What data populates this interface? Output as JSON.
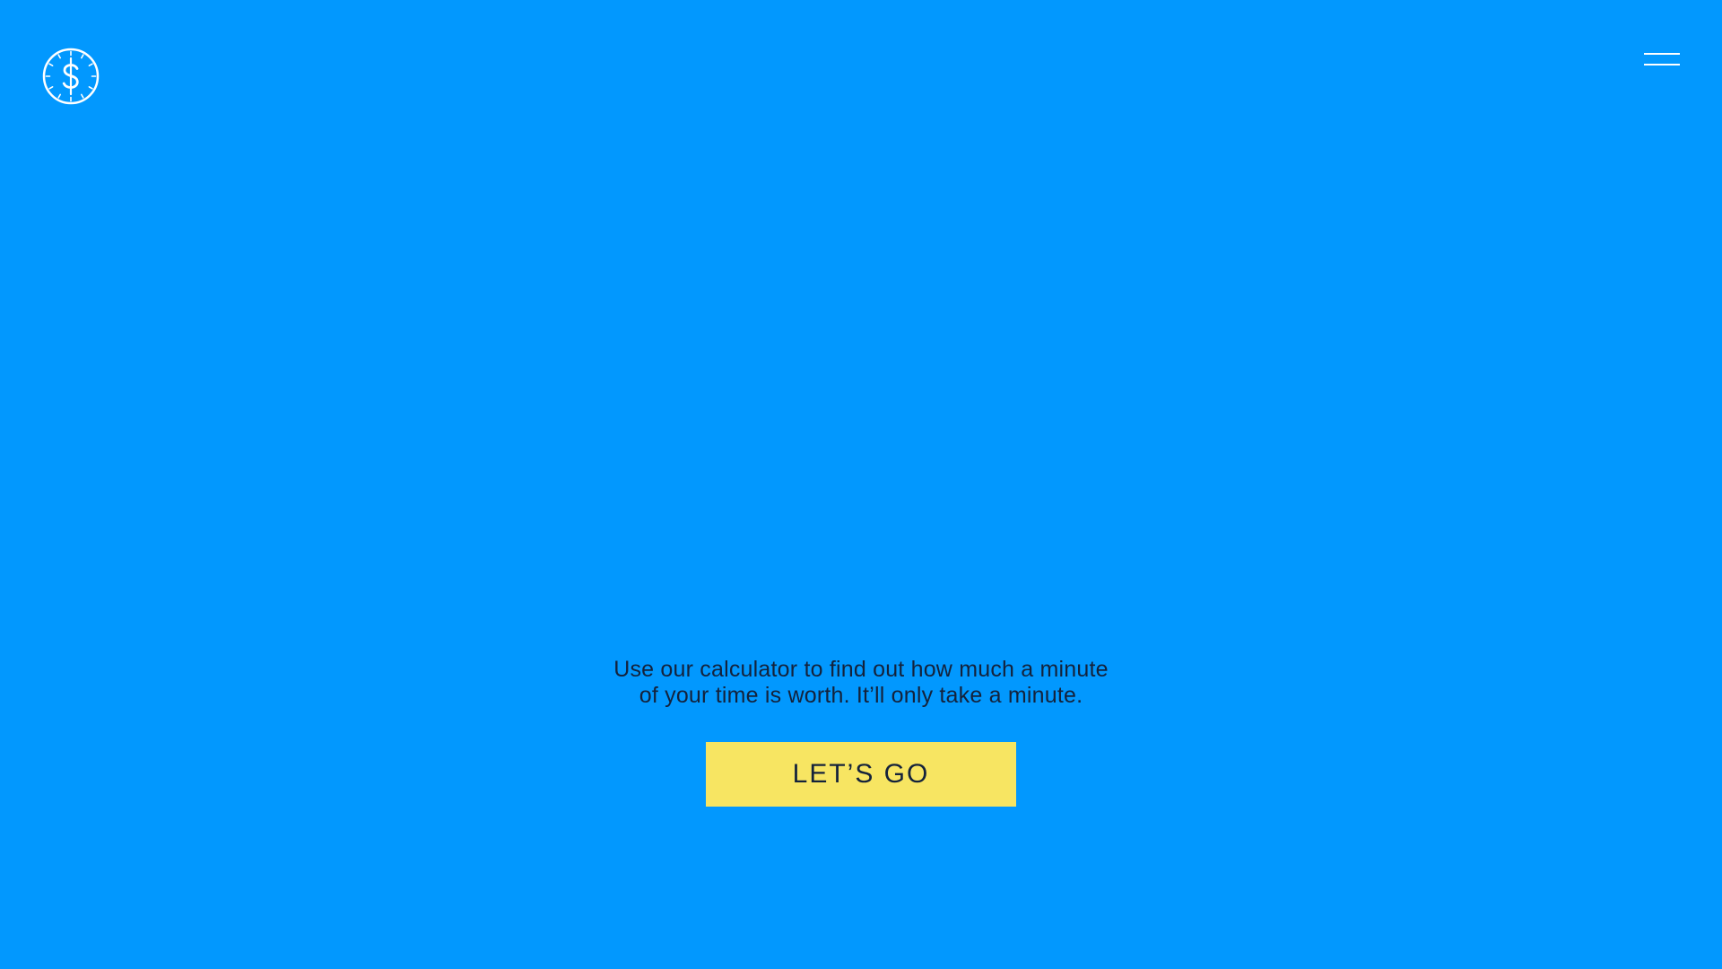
{
  "header": {
    "logo_icon": "clock-dollar-icon",
    "menu_icon": "hamburger-menu-icon"
  },
  "hero": {
    "tagline_line1": "Use our calculator to find out how much a minute",
    "tagline_line2": "of your time is worth. It’ll only take a minute.",
    "cta_label": "LET’S GO"
  },
  "colors": {
    "background": "#0298fe",
    "accent_button": "#f7e562",
    "text_dark": "#14223b",
    "icon": "#ffffff"
  }
}
